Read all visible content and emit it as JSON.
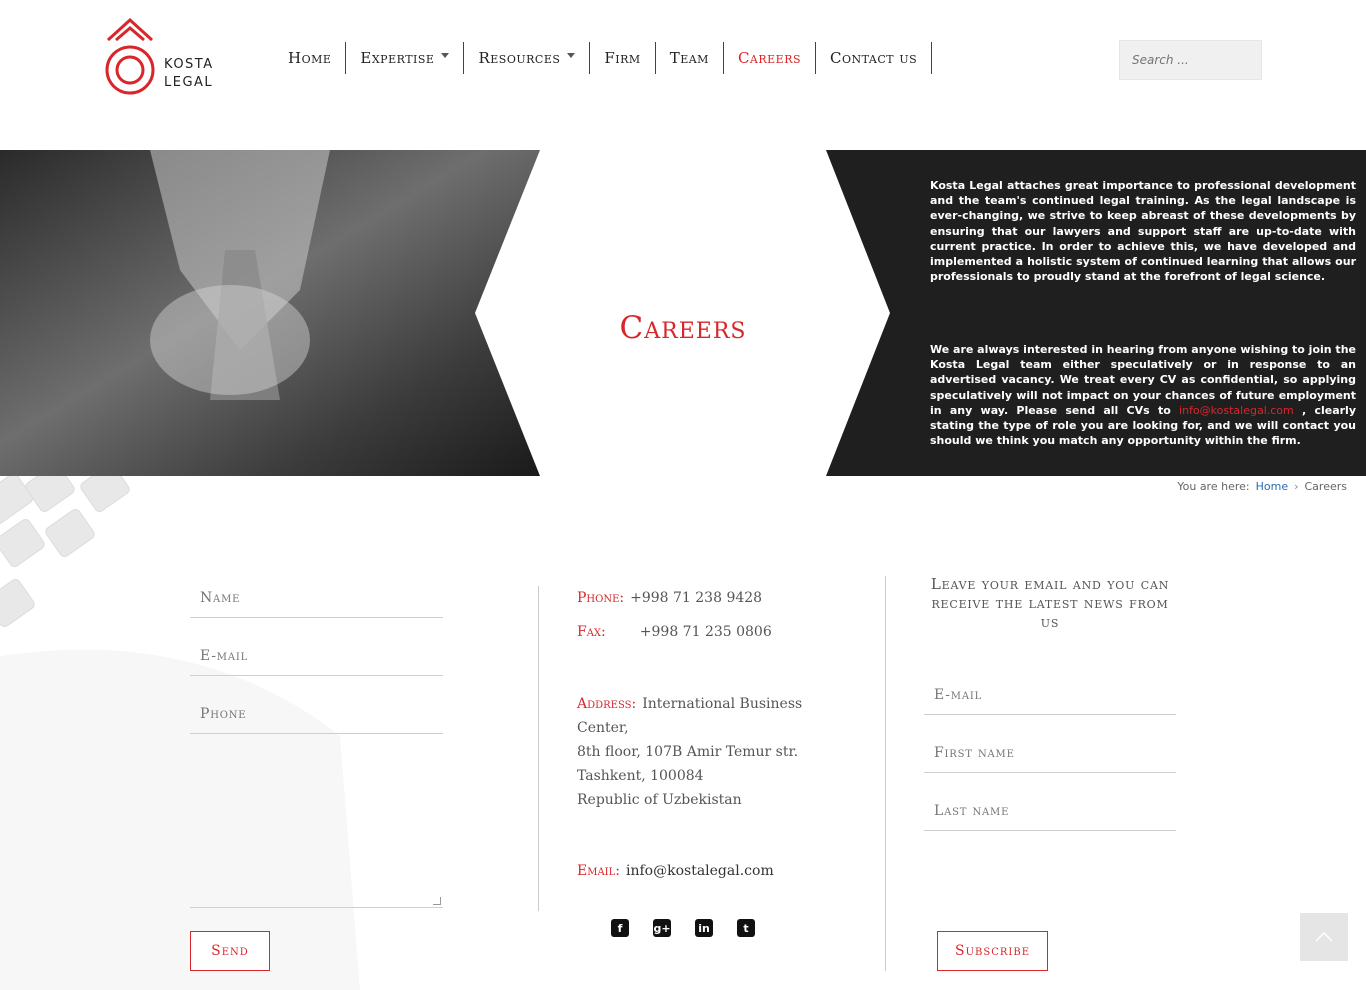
{
  "header": {
    "logo": {
      "line1": "KOSTA",
      "line2": "LEGAL"
    },
    "nav": [
      {
        "label": "Home",
        "dropdown": false,
        "active": false
      },
      {
        "label": "Expertise",
        "dropdown": true,
        "active": false
      },
      {
        "label": "Resources",
        "dropdown": true,
        "active": false
      },
      {
        "label": "Firm",
        "dropdown": false,
        "active": false
      },
      {
        "label": "Team",
        "dropdown": false,
        "active": false
      },
      {
        "label": "Careers",
        "dropdown": false,
        "active": true
      },
      {
        "label": "Contact us",
        "dropdown": false,
        "active": false
      }
    ],
    "search_placeholder": "Search ..."
  },
  "hero": {
    "title": "Careers",
    "paragraph1": "Kosta Legal attaches great importance to professional development and the team's continued legal training. As the legal landscape is ever-changing, we strive to keep abreast of these developments by ensuring that our lawyers and support staff are up-to-date with current practice. In order to achieve this, we have developed and implemented a holistic system of continued learning that allows our professionals to proudly stand at the forefront of legal science.",
    "paragraph2_before": "We are always interested in hearing from anyone wishing to join the Kosta Legal team either speculatively or in response to an advertised vacancy. We treat every CV as confidential, so applying speculatively will not impact on your chances of future employment in any way. Please send all CVs to ",
    "paragraph2_email": "info@kostalegal.com",
    "paragraph2_after": " , clearly stating the type of role you are looking for, and we will contact you should we think you match any opportunity within the firm."
  },
  "breadcrumb": {
    "prefix": "You are here:",
    "home": "Home",
    "separator": "›",
    "current": "Careers"
  },
  "contact_form": {
    "name_placeholder": "Name",
    "email_placeholder": "E-mail",
    "phone_placeholder": "Phone",
    "send_label": "Send"
  },
  "contact_info": {
    "phone_label": "Phone:",
    "phone_value": "+998 71 238 9428",
    "fax_label": "Fax:",
    "fax_value": "+998 71 235 0806",
    "address_label": "Address:",
    "address_line1": "International Business",
    "address_line2": "Center,",
    "address_line3": "8th floor, 107B Amir Temur str.",
    "address_line4": "Tashkent, 100084",
    "address_line5": "Republic of Uzbekistan",
    "email_label": "Email:",
    "email_value": "info@kostalegal.com",
    "social_icons": [
      "facebook-icon",
      "google-plus-icon",
      "linkedin-icon",
      "twitter-icon"
    ]
  },
  "newsletter": {
    "title": "Leave your email and you can receive the latest news from us",
    "email_placeholder": "E-mail",
    "first_name_placeholder": "First name",
    "last_name_placeholder": "Last name",
    "subscribe_label": "Subscribe"
  },
  "colors": {
    "accent": "#d8262b",
    "dark_panel": "#1f1f1f",
    "link_blue": "#2a6ab0"
  }
}
